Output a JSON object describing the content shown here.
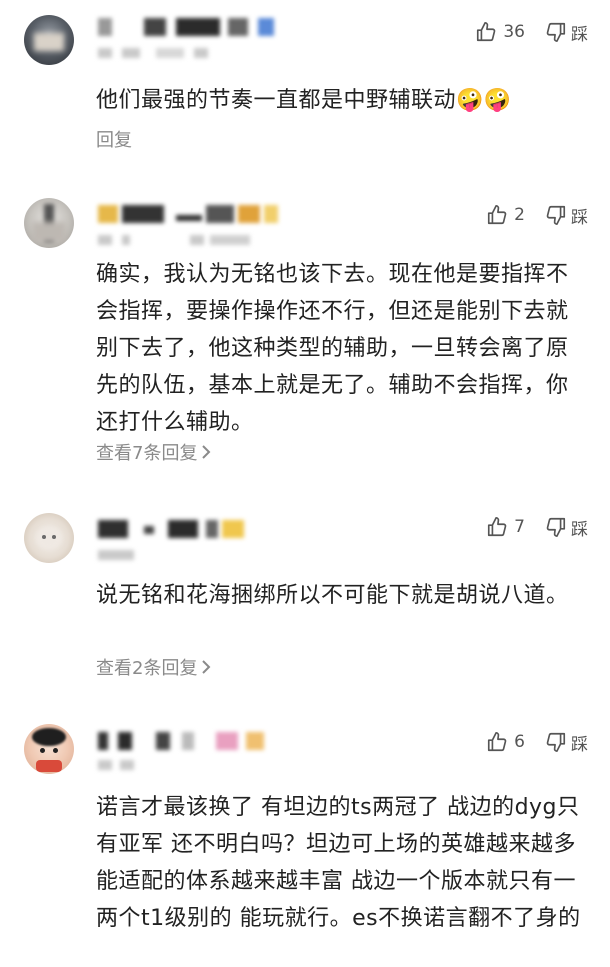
{
  "comments": [
    {
      "likes": "36",
      "dislike_label": "踩",
      "text": "他们最强的节奏一直都是中野辅联动🤪🤪",
      "reply_label": "回复"
    },
    {
      "likes": "2",
      "dislike_label": "踩",
      "text": "确实，我认为无铭也该下去。现在他是要指挥不会指挥，要操作操作还不行，但还是能别下去就别下去了，他这种类型的辅助，一旦转会离了原先的队伍，基本上就是无了。辅助不会指挥，你还打什么辅助。",
      "reply_label": "查看7条回复"
    },
    {
      "likes": "7",
      "dislike_label": "踩",
      "text": "说无铭和花海捆绑所以不可能下就是胡说八道。",
      "reply_label": "查看2条回复"
    },
    {
      "likes": "6",
      "dislike_label": "踩",
      "text": "诺言才最该换了 有坦边的ts两冠了 战边的dyg只有亚军 还不明白吗？坦边可上场的英雄越来越多 能适配的体系越来越丰富 战边一个版本就只有一两个t1级别的 能玩就行。es不换诺言翻不了身的"
    }
  ],
  "colors": {
    "text": "#222222",
    "meta": "#8a8a8a",
    "icon": "#555555"
  },
  "icons": {
    "like": "thumbs-up-icon",
    "dislike": "thumbs-down-icon",
    "chevron": "chevron-right-icon"
  }
}
